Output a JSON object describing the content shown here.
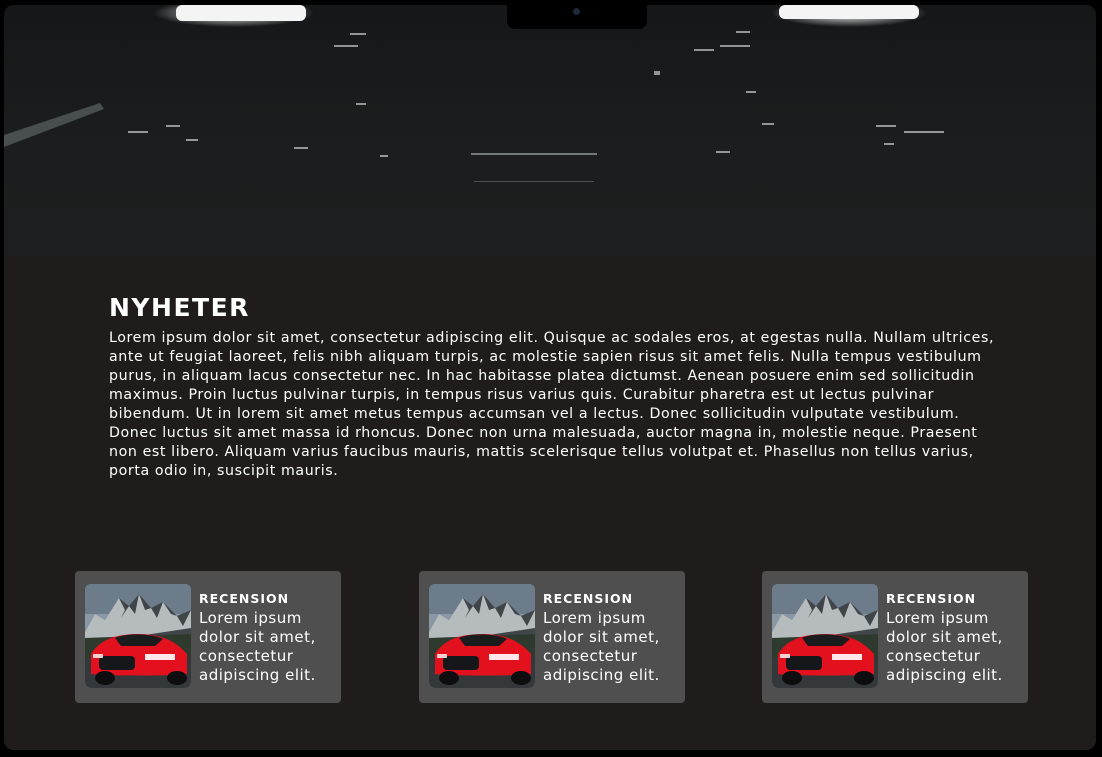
{
  "news": {
    "title": "NYHETER",
    "body": "Lorem ipsum dolor sit amet, consectetur adipiscing elit. Quisque ac sodales eros, at egestas nulla. Nullam ultrices, ante ut feugiat laoreet, felis nibh aliquam turpis, ac molestie sapien risus sit amet felis. Nulla tempus vestibulum purus, in aliquam lacus consectetur nec. In hac habitasse platea dictumst. Aenean posuere enim sed sollicitudin maximus. Proin luctus pulvinar turpis, in tempus risus varius quis. Curabitur pharetra est ut lectus pulvinar bibendum. Ut in lorem sit amet metus tempus accumsan vel a lectus. Donec sollicitudin vulputate vestibulum. Donec luctus sit amet massa id rhoncus. Donec non urna malesuada, auctor magna in, molestie neque. Praesent non est libero. Aliquam varius faucibus mauris, mattis scelerisque tellus volutpat et. Phasellus non tellus varius, porta odio in, suscipit mauris."
  },
  "reviews": [
    {
      "title": "RECENSION",
      "text": "Lorem ipsum dolor sit amet, consectetur adipiscing elit.",
      "image": "red-sports-car-mountains"
    },
    {
      "title": "RECENSION",
      "text": "Lorem ipsum dolor sit amet, consectetur adipiscing elit.",
      "image": "red-sports-car-mountains"
    },
    {
      "title": "RECENSION",
      "text": "Lorem ipsum dolor sit amet, consectetur adipiscing elit.",
      "image": "red-sports-car-mountains"
    }
  ],
  "colors": {
    "page_background": "#201c1c",
    "card_background": "#4f4f4f",
    "text": "#ffffff",
    "car_red": "#e3101d"
  }
}
